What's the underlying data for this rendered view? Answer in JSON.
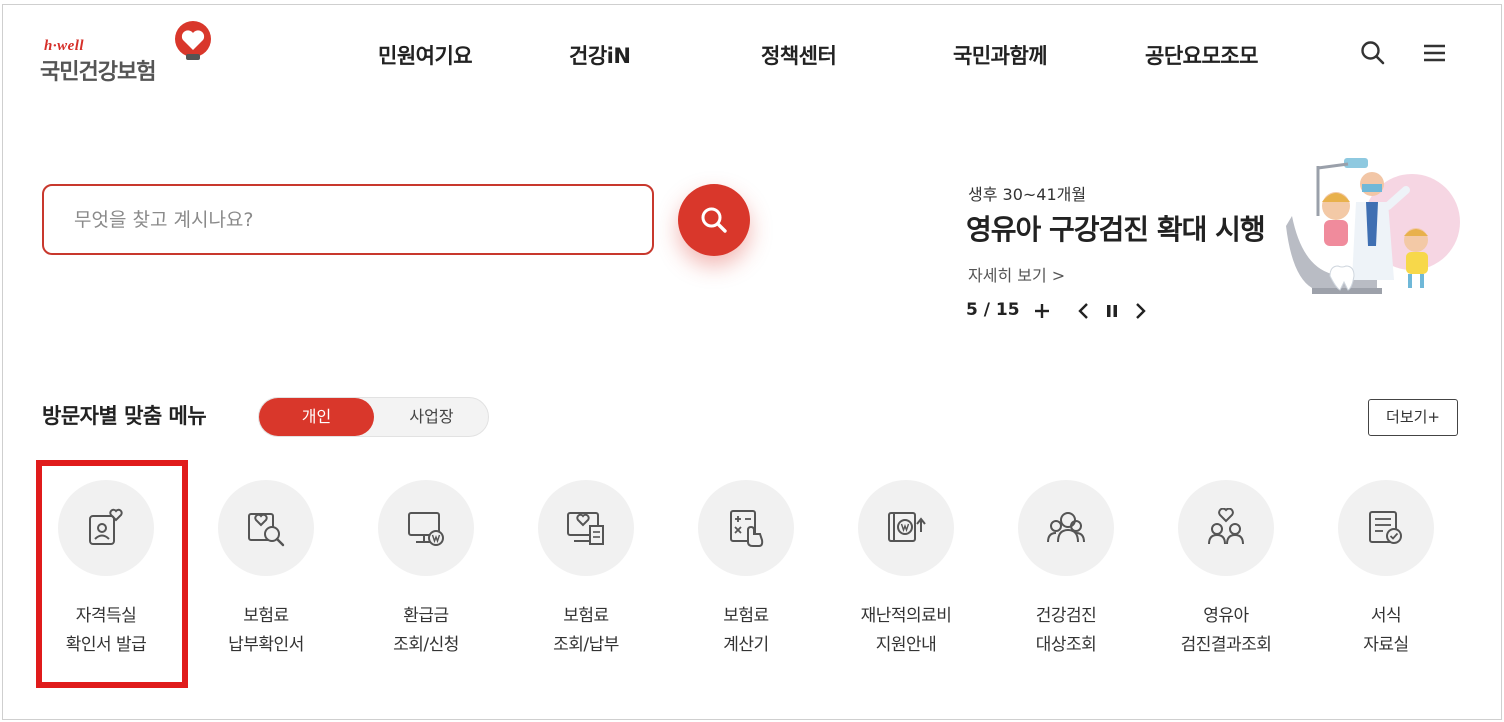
{
  "header": {
    "logo_small": "h·well",
    "logo_main": "국민건강보험",
    "nav": [
      {
        "label": "민원여기요"
      },
      {
        "label": "건강iN"
      },
      {
        "label": "정책센터"
      },
      {
        "label": "국민과함께"
      },
      {
        "label": "공단요모조모"
      }
    ],
    "icons": [
      "search-icon",
      "hamburger-menu-icon"
    ]
  },
  "search": {
    "placeholder": "무엇을 찾고 계시나요?",
    "value": ""
  },
  "banner": {
    "subtitle": "생후 30~41개월",
    "title": "영유아 구강검진 확대 시행",
    "more_link": "자세히 보기 >",
    "pager": "5 / 15"
  },
  "visitor_menu": {
    "title": "방문자별 맞춤 메뉴",
    "toggle": {
      "active": "개인",
      "inactive": "사업장"
    },
    "more_button": "더보기+",
    "items": [
      {
        "line1": "자격득실",
        "line2": "확인서 발급",
        "icon": "id-card-heart-icon"
      },
      {
        "line1": "보험료",
        "line2": "납부확인서",
        "icon": "document-search-icon"
      },
      {
        "line1": "환급금",
        "line2": "조회/신청",
        "icon": "monitor-refund-icon"
      },
      {
        "line1": "보험료",
        "line2": "조회/납부",
        "icon": "monitor-document-icon"
      },
      {
        "line1": "보험료",
        "line2": "계산기",
        "icon": "calculator-icon"
      },
      {
        "line1": "재난적의료비",
        "line2": "지원안내",
        "icon": "money-support-icon"
      },
      {
        "line1": "건강검진",
        "line2": "대상조회",
        "icon": "people-search-icon"
      },
      {
        "line1": "영유아",
        "line2": "검진결과조회",
        "icon": "family-heart-icon"
      },
      {
        "line1": "서식",
        "line2": "자료실",
        "icon": "form-document-icon"
      }
    ]
  },
  "colors": {
    "brand_red": "#d9372b",
    "highlight_red": "#e01b1b",
    "icon_bg": "#f1f1f1"
  }
}
